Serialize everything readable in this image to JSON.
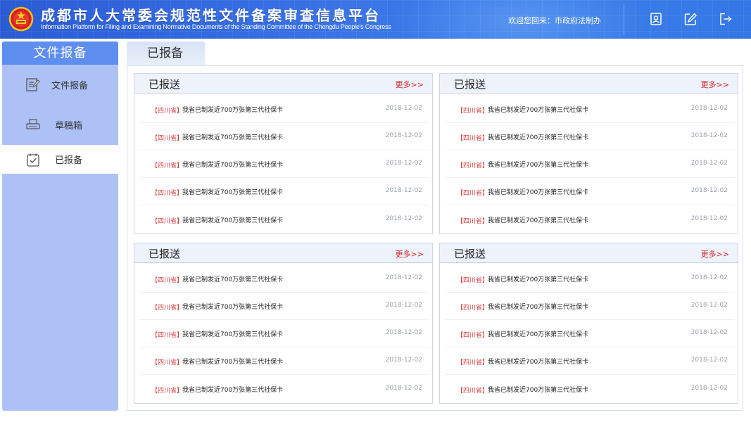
{
  "header": {
    "title_cn": "成都市人大常委会规范性文件备案审查信息平台",
    "title_en": "Information Platform for Filing and Examining Normative Documents of the Standing Committee of the Chengdu People's Congress",
    "welcome": "欢迎您回来：市政府法制办",
    "icons": [
      "user-card-icon",
      "edit-icon",
      "logout-icon"
    ]
  },
  "sidebar": {
    "header": "文件报备",
    "items": [
      {
        "label": "文件报备",
        "icon": "document-edit-icon"
      },
      {
        "label": "草稿箱",
        "icon": "printer-icon"
      },
      {
        "label": "已报备",
        "icon": "checked-clipboard-icon",
        "active": true
      }
    ]
  },
  "main": {
    "tab": "已报备",
    "panels": [
      {
        "title": "已报送",
        "more": "更多>>",
        "rows": [
          {
            "tag": "【四川省】",
            "text": "我省已制发近700万张第三代社保卡",
            "date": "2018-12-02"
          },
          {
            "tag": "【四川省】",
            "text": "我省已制发近700万张第三代社保卡",
            "date": "2018-12-02"
          },
          {
            "tag": "【四川省】",
            "text": "我省已制发近700万张第三代社保卡",
            "date": "2018-12-02"
          },
          {
            "tag": "【四川省】",
            "text": "我省已制发近700万张第三代社保卡",
            "date": "2018-12-02"
          },
          {
            "tag": "【四川省】",
            "text": "我省已制发近700万张第三代社保卡",
            "date": "2018-12-02"
          }
        ]
      },
      {
        "title": "已报送",
        "more": "更多>>",
        "rows": [
          {
            "tag": "【四川省】",
            "text": "我省已制发近700万张第三代社保卡",
            "date": "2018-12-02"
          },
          {
            "tag": "【四川省】",
            "text": "我省已制发近700万张第三代社保卡",
            "date": "2018-12-02"
          },
          {
            "tag": "【四川省】",
            "text": "我省已制发近700万张第三代社保卡",
            "date": "2018-12-02"
          },
          {
            "tag": "【四川省】",
            "text": "我省已制发近700万张第三代社保卡",
            "date": "2018-12-02"
          },
          {
            "tag": "【四川省】",
            "text": "我省已制发近700万张第三代社保卡",
            "date": "2018-12-02"
          }
        ]
      },
      {
        "title": "已报送",
        "more": "更多>>",
        "rows": [
          {
            "tag": "【四川省】",
            "text": "我省已制发近700万张第三代社保卡",
            "date": "2018-12-02"
          },
          {
            "tag": "【四川省】",
            "text": "我省已制发近700万张第三代社保卡",
            "date": "2018-12-02"
          },
          {
            "tag": "【四川省】",
            "text": "我省已制发近700万张第三代社保卡",
            "date": "2018-12-02"
          },
          {
            "tag": "【四川省】",
            "text": "我省已制发近700万张第三代社保卡",
            "date": "2018-12-02"
          },
          {
            "tag": "【四川省】",
            "text": "我省已制发近700万张第三代社保卡",
            "date": "2018-12-02"
          }
        ]
      },
      {
        "title": "已报送",
        "more": "更多>>",
        "rows": [
          {
            "tag": "【四川省】",
            "text": "我省已制发近700万张第三代社保卡",
            "date": "2018-12-02"
          },
          {
            "tag": "【四川省】",
            "text": "我省已制发近700万张第三代社保卡",
            "date": "2018-12-02"
          },
          {
            "tag": "【四川省】",
            "text": "我省已制发近700万张第三代社保卡",
            "date": "2018-12-02"
          },
          {
            "tag": "【四川省】",
            "text": "我省已制发近700万张第三代社保卡",
            "date": "2018-12-02"
          },
          {
            "tag": "【四川省】",
            "text": "我省已制发近700万张第三代社保卡",
            "date": "2018-12-02"
          }
        ]
      }
    ]
  },
  "colors": {
    "header_blue": "#3a73e6",
    "sidebar_bg": "#aec1f7",
    "sidebar_header": "#5e8ef0",
    "accent_red": "#d22a2a"
  }
}
